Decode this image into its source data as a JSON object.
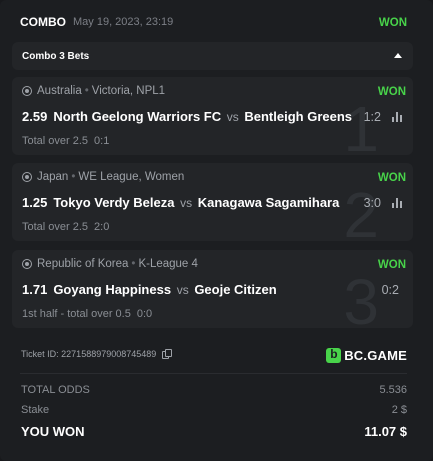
{
  "header": {
    "title": "COMBO",
    "date": "May 19, 2023, 23:19",
    "status": "WON"
  },
  "combo_bar": {
    "label": "Combo 3 Bets",
    "expanded": true
  },
  "bets": [
    {
      "index": "1",
      "country": "Australia",
      "league": "Victoria, NPL1",
      "status": "WON",
      "odds": "2.59",
      "home": "North Geelong Warriors FC",
      "vs": "vs",
      "away": "Bentleigh Greens",
      "score": "1:2",
      "market": "Total over 2.5",
      "result": "0:1"
    },
    {
      "index": "2",
      "country": "Japan",
      "league": "WE League, Women",
      "status": "WON",
      "odds": "1.25",
      "home": "Tokyo Verdy Beleza",
      "vs": "vs",
      "away": "Kanagawa Sagamihara",
      "score": "3:0",
      "market": "Total over 2.5",
      "result": "2:0"
    },
    {
      "index": "3",
      "country": "Republic of Korea",
      "league": "K-League 4",
      "status": "WON",
      "odds": "1.71",
      "home": "Goyang Happiness",
      "vs": "vs",
      "away": "Geoje Citizen",
      "score": "0:2",
      "market": "1st half - total over 0.5",
      "result": "0:0"
    }
  ],
  "ticket": {
    "label": "Ticket ID: 2271588979008745489"
  },
  "brand": {
    "name": "BC.GAME",
    "color": "#48d34a"
  },
  "summary": {
    "total_odds_label": "TOTAL ODDS",
    "total_odds_value": "5.536",
    "stake_label": "Stake",
    "stake_value": "2 $",
    "won_label": "YOU WON",
    "won_value": "11.07 $"
  },
  "colors": {
    "won": "#48d34a",
    "background": "#1c1e21",
    "panel": "#232528"
  }
}
